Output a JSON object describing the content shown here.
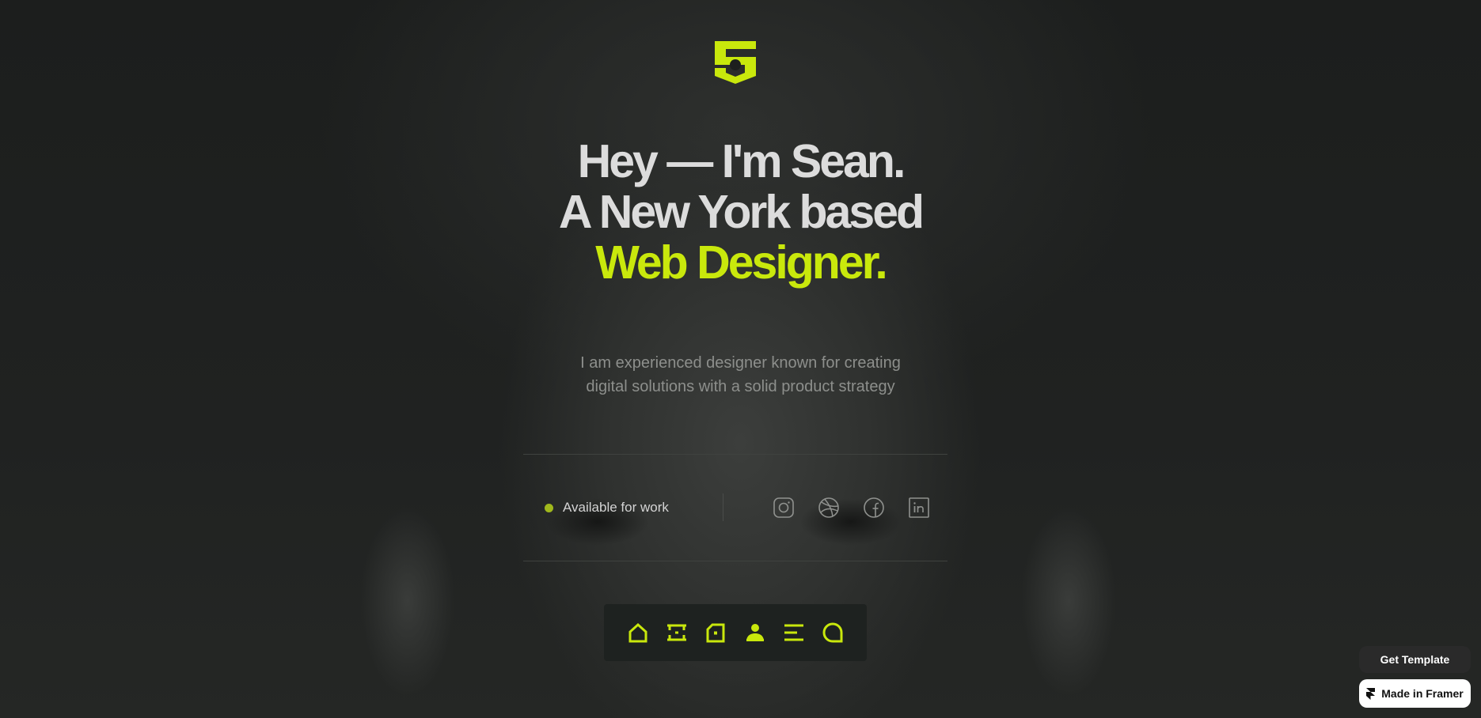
{
  "colors": {
    "accent": "#c9e80c",
    "status_dot": "#a0b81c",
    "headline": "#dcdcdc",
    "body_text": "#8d8f8c",
    "background": "#1a1c1b",
    "dock_background": "#1e2220"
  },
  "brand": {
    "logo_icon": "s-shield-logo-icon"
  },
  "hero": {
    "line1": "Hey — I'm Sean.",
    "line2": "A New York based",
    "line3": "Web Designer."
  },
  "intro": {
    "line1": "I am experienced designer known for creating",
    "line2": "digital solutions with a solid product strategy"
  },
  "availability": {
    "label": "Available for work"
  },
  "socials": [
    {
      "icon": "instagram-icon"
    },
    {
      "icon": "dribbble-icon"
    },
    {
      "icon": "facebook-icon"
    },
    {
      "icon": "linkedin-icon"
    }
  ],
  "dock": [
    {
      "icon": "home-icon"
    },
    {
      "icon": "services-icon"
    },
    {
      "icon": "projects-icon"
    },
    {
      "icon": "about-icon"
    },
    {
      "icon": "menu-icon"
    },
    {
      "icon": "contact-icon"
    }
  ],
  "footer_badges": {
    "get_template": "Get Template",
    "made_in_framer": "Made in Framer"
  }
}
